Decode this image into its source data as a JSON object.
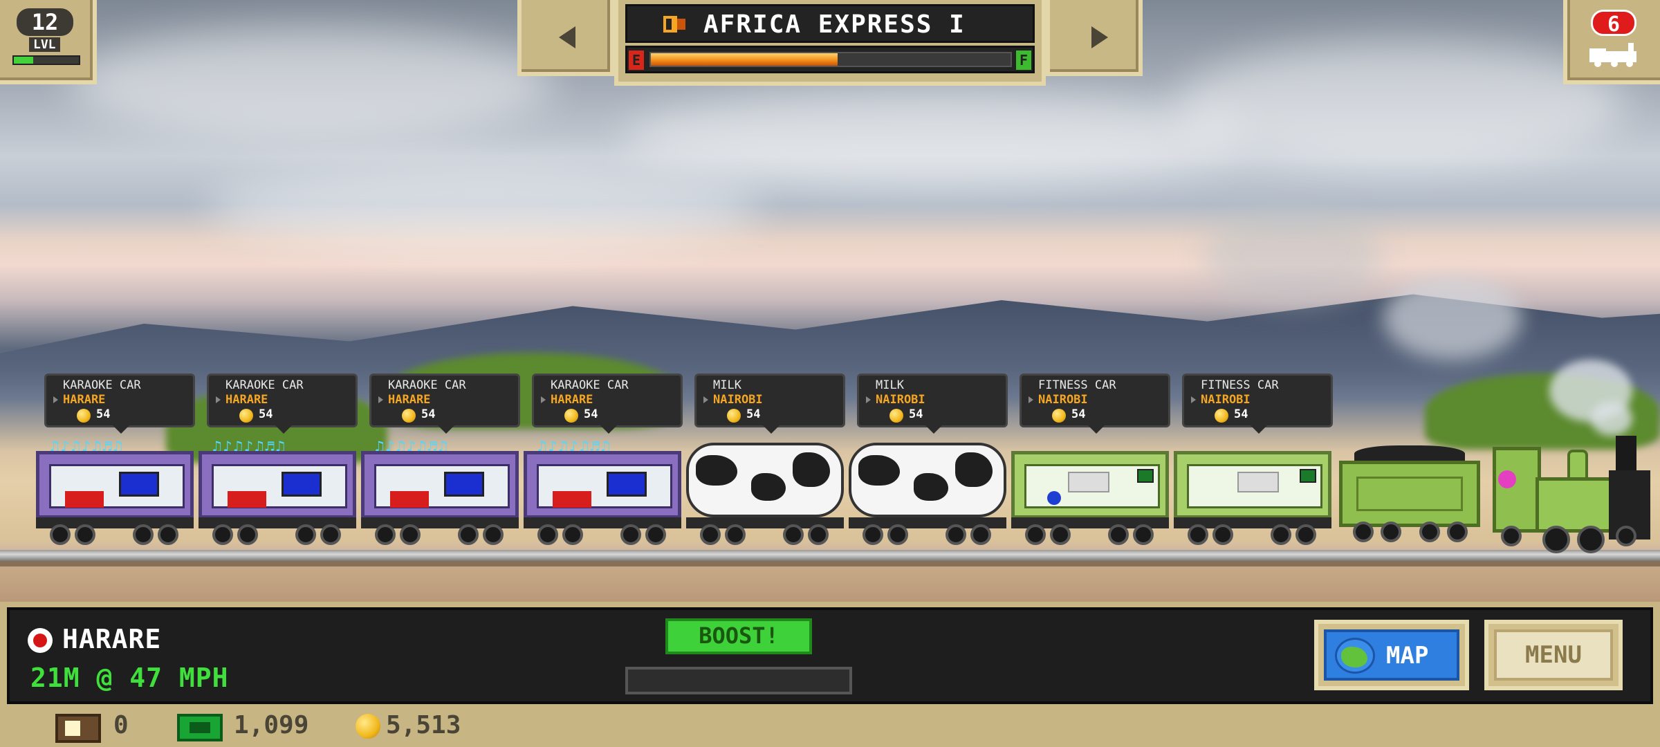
{
  "level": {
    "number": "12",
    "label": "LVL",
    "progress": 0.3
  },
  "train": {
    "name": "AFRICA EXPRESS I",
    "fuel_empty": "E",
    "fuel_full": "F",
    "fuel_level": 0.52
  },
  "crew": {
    "count": "6"
  },
  "cars": [
    {
      "type": "karaoke",
      "title": "KARAOKE CAR",
      "dest": "HARARE",
      "pay": "54"
    },
    {
      "type": "karaoke",
      "title": "KARAOKE CAR",
      "dest": "HARARE",
      "pay": "54"
    },
    {
      "type": "karaoke",
      "title": "KARAOKE CAR",
      "dest": "HARARE",
      "pay": "54"
    },
    {
      "type": "karaoke",
      "title": "KARAOKE CAR",
      "dest": "HARARE",
      "pay": "54"
    },
    {
      "type": "milk",
      "title": "MILK",
      "dest": "NAIROBI",
      "pay": "54"
    },
    {
      "type": "milk",
      "title": "MILK",
      "dest": "NAIROBI",
      "pay": "54"
    },
    {
      "type": "fitness",
      "title": "FITNESS CAR",
      "dest": "NAIROBI",
      "pay": "54"
    },
    {
      "type": "fitness",
      "title": "FITNESS CAR",
      "dest": "NAIROBI",
      "pay": "54"
    }
  ],
  "hud": {
    "station": "HARARE",
    "speed": "21M @ 47 MPH",
    "boost_label": "BOOST!",
    "boost_progress": 0,
    "map_label": "MAP",
    "menu_label": "MENU"
  },
  "resources": {
    "tickets": "0",
    "cash": "1,099",
    "coins": "5,513"
  },
  "colors": {
    "accent_green": "#3fe03c",
    "accent_orange": "#f5a623",
    "map_blue": "#2f7fe0"
  }
}
